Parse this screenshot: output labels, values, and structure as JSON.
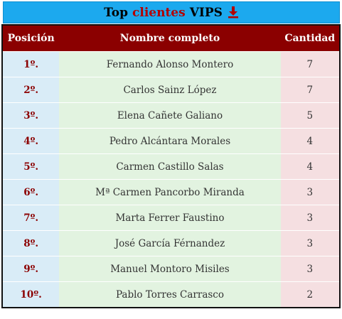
{
  "header": {
    "title_prefix": "Top",
    "title_accent": "clientes",
    "title_suffix": "VIPS"
  },
  "colors": {
    "title_bar": "#1ca9ee",
    "header_row": "#8b0000",
    "position_col": "#d9ecf7",
    "name_col": "#e2f3e0",
    "qty_col": "#f5dfe1",
    "accent_text": "#b30000"
  },
  "icons": {
    "download": "download-arrow-icon"
  },
  "table": {
    "columns": [
      "Posición",
      "Nombre completo",
      "Cantidad"
    ],
    "rows": [
      {
        "pos": "1º.",
        "name": "Fernando Alonso Montero",
        "qty": "7"
      },
      {
        "pos": "2º.",
        "name": "Carlos Sainz López",
        "qty": "7"
      },
      {
        "pos": "3º.",
        "name": "Elena Cañete Galiano",
        "qty": "5"
      },
      {
        "pos": "4º.",
        "name": "Pedro Alcántara Morales",
        "qty": "4"
      },
      {
        "pos": "5º.",
        "name": "Carmen Castillo Salas",
        "qty": "4"
      },
      {
        "pos": "6º.",
        "name": "Mª Carmen Pancorbo Miranda",
        "qty": "3"
      },
      {
        "pos": "7º.",
        "name": "Marta Ferrer Faustino",
        "qty": "3"
      },
      {
        "pos": "8º.",
        "name": "José García Férnandez",
        "qty": "3"
      },
      {
        "pos": "9º.",
        "name": "Manuel Montoro Misiles",
        "qty": "3"
      },
      {
        "pos": "10º.",
        "name": "Pablo Torres Carrasco",
        "qty": "2"
      }
    ]
  }
}
